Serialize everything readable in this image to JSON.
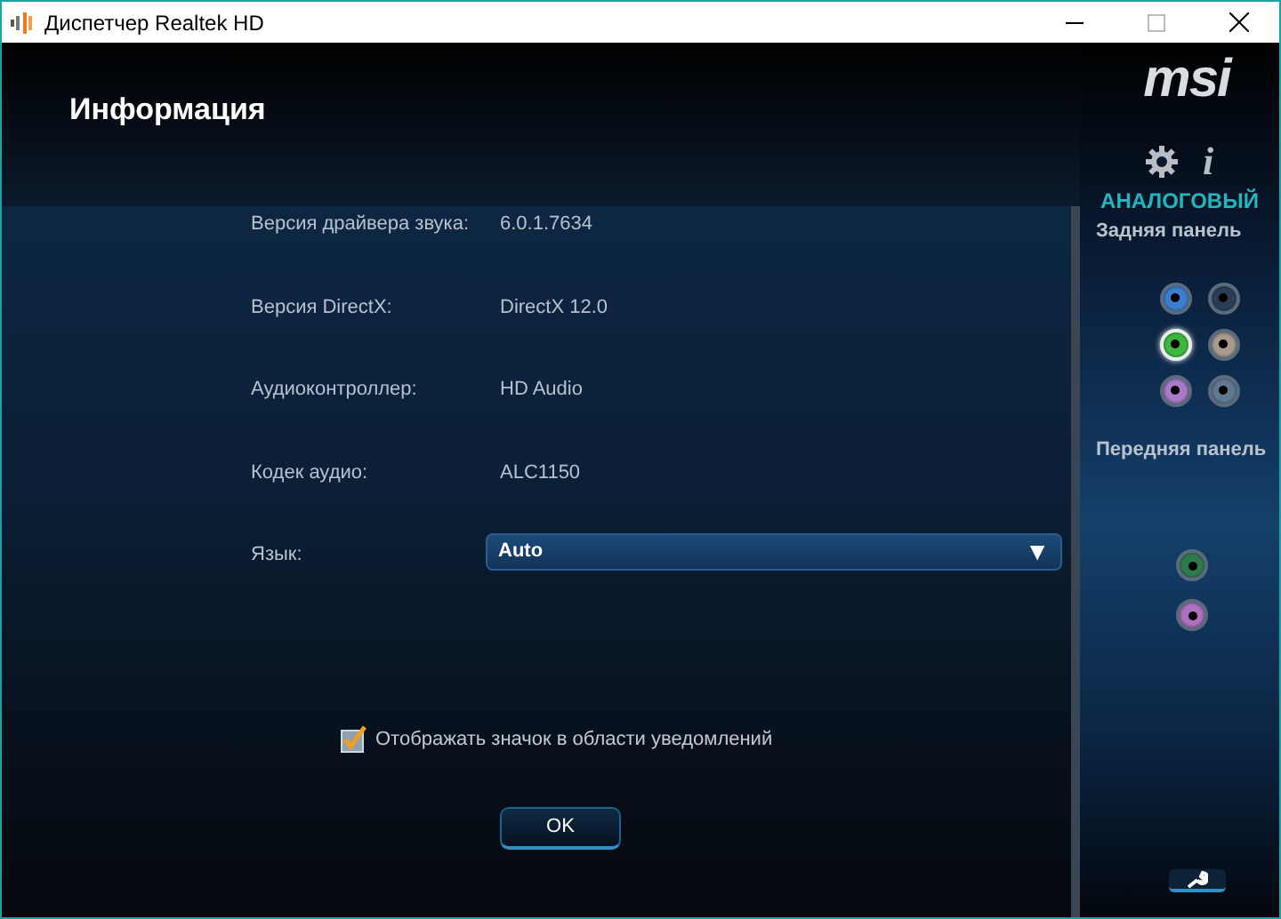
{
  "window": {
    "title": "Диспетчер Realtek HD"
  },
  "page_title": "Информация",
  "info_rows": [
    {
      "label": "Версия драйвера звука:",
      "value": "6.0.1.7634"
    },
    {
      "label": "Версия DirectX:",
      "value": "DirectX 12.0"
    },
    {
      "label": "Аудиоконтроллер:",
      "value": "HD Audio"
    },
    {
      "label": "Кодек аудио:",
      "value": "ALC1150"
    }
  ],
  "language": {
    "label": "Язык:",
    "value": "Auto",
    "arrow": "▼"
  },
  "tray_icon_checkbox": {
    "label": "Отображать значок в области уведомлений",
    "checked": true
  },
  "ok_button": "OK",
  "sidebar": {
    "logo": "msi",
    "info_glyph": "i",
    "section": "АНАЛОГОВЫЙ",
    "rear_panel": {
      "title": "Задняя панель",
      "jacks": [
        {
          "color": "#3a7fd0",
          "selected": false
        },
        {
          "color": "#2a3d55",
          "selected": false
        },
        {
          "color": "#3cb83c",
          "selected": true
        },
        {
          "color": "#a89a8c",
          "selected": false
        },
        {
          "color": "#a87ac8",
          "selected": false
        },
        {
          "color": "#607890",
          "selected": false
        }
      ]
    },
    "front_panel": {
      "title": "Передняя панель",
      "jacks": [
        {
          "color": "#2f7a4a",
          "selected": false
        },
        {
          "color": "#b070c0",
          "selected": false
        }
      ]
    }
  }
}
